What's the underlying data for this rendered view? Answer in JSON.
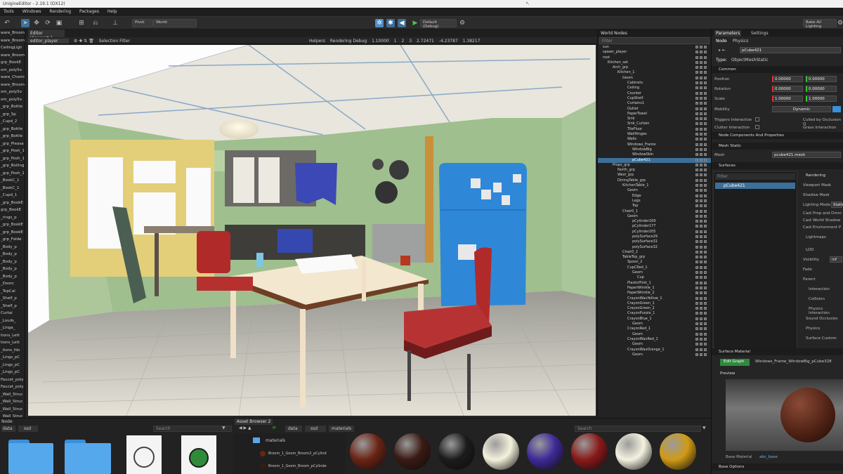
{
  "window": {
    "title": "UnigineEditor - 2.19.1 (DX12)"
  },
  "menu": [
    "Tools",
    "Windows",
    "Rendering",
    "Packages",
    "Help"
  ],
  "toolbar": {
    "pivot_label": "Pivot",
    "space_label": "World",
    "run_config": "Default (Debug)",
    "bake_lighting": "Bake All Lighting"
  },
  "left_panel_items": [
    "ware_Broom",
    "ware_Broom",
    "CeilingLigh",
    "ware_Broom",
    "grp_BookE",
    "om_poly5o",
    "ware_Chemic",
    "ware_Broom",
    "om_poly5o",
    "om_poly5o",
    "_grp_Bottle",
    "_grp_Sp",
    "_Cupd_2",
    "_grp_Bottle",
    "_grp_Bottle",
    "_grp_Pleasa",
    "_grp_Posh_1",
    "_grp_Posh_1",
    "_grp_Boiling",
    "_grp_Posh_1",
    "_BookC_1",
    "_BookC_1",
    "_Cupd_1",
    "_grp_BookE",
    "grp_BookE",
    "_rings_p",
    "_grp_BookE",
    "_grp_BookE",
    "_grp_Folde",
    "_Body_p",
    "_Body_p",
    "_Body_p",
    "_Body_p",
    "_Body_p",
    "_Doorc",
    "_TopCal",
    "_Shelf_p",
    "_Shelf_p",
    "Curtai",
    "_Louds_",
    "_Linga_",
    "tions_Lett",
    "tions_Lett",
    "_tions_fds",
    "_Lings_pC",
    "_Lings_pC",
    "_Lings_pC",
    "Faucet_poly",
    "Faucet_poly",
    "_Wall_Struc",
    "_Wall_Struc",
    "_Wall_Struc",
    "_Wall_Struc"
  ],
  "viewport": {
    "tab_label": "Editor Viewport 1",
    "camera": "editor_player",
    "selection_filter": "Selection Filter",
    "helpers": "Helpers",
    "rendering_debug": "Rendering Debug",
    "fields": [
      "1.10000",
      "1",
      "2",
      "3",
      "2.72471",
      "-4.23787",
      "1.38217"
    ]
  },
  "world_nodes": {
    "tab_label": "World Nodes",
    "filter_placeholder": "Filter",
    "rows": [
      {
        "label": "sun",
        "indent": 1,
        "selected": false
      },
      {
        "label": "spawn_player",
        "indent": 1,
        "selected": false
      },
      {
        "label": "root",
        "indent": 1,
        "selected": false
      },
      {
        "label": "Kitchen_set",
        "indent": 2,
        "selected": false
      },
      {
        "label": "Arch_grp",
        "indent": 3,
        "selected": false
      },
      {
        "label": "Kitchen_1",
        "indent": 4,
        "selected": false
      },
      {
        "label": "Geom",
        "indent": 5,
        "selected": false
      },
      {
        "label": "Cabinets",
        "indent": 6,
        "selected": false
      },
      {
        "label": "Ceiling",
        "indent": 6,
        "selected": false
      },
      {
        "label": "Counter",
        "indent": 6,
        "selected": false
      },
      {
        "label": "CupShelf",
        "indent": 6,
        "selected": false
      },
      {
        "label": "Curtains1",
        "indent": 6,
        "selected": false
      },
      {
        "label": "Outlet",
        "indent": 6,
        "selected": false
      },
      {
        "label": "PaperTowel",
        "indent": 6,
        "selected": false
      },
      {
        "label": "Sink",
        "indent": 6,
        "selected": false
      },
      {
        "label": "Sink_Curtain",
        "indent": 6,
        "selected": false
      },
      {
        "label": "TileFloor",
        "indent": 6,
        "selected": false
      },
      {
        "label": "WallHinges",
        "indent": 6,
        "selected": false
      },
      {
        "label": "Walls",
        "indent": 6,
        "selected": false
      },
      {
        "label": "Windows_Frame",
        "indent": 6,
        "selected": false
      },
      {
        "label": "WindowBig",
        "indent": 7,
        "selected": false
      },
      {
        "label": "WindowSkin",
        "indent": 7,
        "selected": false
      },
      {
        "label": "pCube421",
        "indent": 7,
        "selected": true
      },
      {
        "label": "Props_grp",
        "indent": 3,
        "selected": false
      },
      {
        "label": "North_grp",
        "indent": 4,
        "selected": false
      },
      {
        "label": "West_grp",
        "indent": 4,
        "selected": false
      },
      {
        "label": "DiningTable_grp",
        "indent": 4,
        "selected": false
      },
      {
        "label": "KitchenTable_1",
        "indent": 5,
        "selected": false
      },
      {
        "label": "Geom",
        "indent": 6,
        "selected": false
      },
      {
        "label": "Edge",
        "indent": 7,
        "selected": false
      },
      {
        "label": "Legs",
        "indent": 7,
        "selected": false
      },
      {
        "label": "Top",
        "indent": 7,
        "selected": false
      },
      {
        "label": "Chair0_1",
        "indent": 5,
        "selected": false
      },
      {
        "label": "Geom",
        "indent": 6,
        "selected": false
      },
      {
        "label": "pCylinder169",
        "indent": 7,
        "selected": false
      },
      {
        "label": "pCylinder177",
        "indent": 7,
        "selected": false
      },
      {
        "label": "pCylinder205",
        "indent": 7,
        "selected": false
      },
      {
        "label": "polySurface29",
        "indent": 7,
        "selected": false
      },
      {
        "label": "polySurface31",
        "indent": 7,
        "selected": false
      },
      {
        "label": "polySurface32",
        "indent": 7,
        "selected": false
      },
      {
        "label": "Chair0_2",
        "indent": 5,
        "selected": false
      },
      {
        "label": "TableTop_grp",
        "indent": 5,
        "selected": false
      },
      {
        "label": "Spoon_2",
        "indent": 6,
        "selected": false
      },
      {
        "label": "CupCRed_1",
        "indent": 6,
        "selected": false
      },
      {
        "label": "Geom",
        "indent": 7,
        "selected": false
      },
      {
        "label": "Cup",
        "indent": 8,
        "selected": false
      },
      {
        "label": "PlasticPlink_1",
        "indent": 6,
        "selected": false
      },
      {
        "label": "PaperWrinkle_1",
        "indent": 6,
        "selected": false
      },
      {
        "label": "PaperWrinkle_2",
        "indent": 6,
        "selected": false
      },
      {
        "label": "CrayonWaxYellow_1",
        "indent": 6,
        "selected": false
      },
      {
        "label": "CrayonGreen_1",
        "indent": 6,
        "selected": false
      },
      {
        "label": "CrayonGreen_2",
        "indent": 6,
        "selected": false
      },
      {
        "label": "CrayonPurple_1",
        "indent": 6,
        "selected": false
      },
      {
        "label": "CrayonBlue_1",
        "indent": 6,
        "selected": false
      },
      {
        "label": "Geom",
        "indent": 7,
        "selected": false
      },
      {
        "label": "CrayonRed_1",
        "indent": 6,
        "selected": false
      },
      {
        "label": "Geom",
        "indent": 7,
        "selected": false
      },
      {
        "label": "CrayonWaxRed_1",
        "indent": 6,
        "selected": false
      },
      {
        "label": "Geom",
        "indent": 7,
        "selected": false
      },
      {
        "label": "CrayonWaxOrange_1",
        "indent": 6,
        "selected": false
      },
      {
        "label": "Geom",
        "indent": 7,
        "selected": false
      }
    ]
  },
  "parameters": {
    "tabs": [
      "Parameters",
      "Settings"
    ],
    "subtabs": [
      "Node",
      "Physics"
    ],
    "node_name": "pCube421",
    "type_label": "Type:",
    "type_value": "ObjectMeshStatic",
    "common_label": "Common",
    "position_label": "Position",
    "rotation_label": "Rotation",
    "scale_label": "Scale",
    "position": [
      "0.00000",
      "0.00000"
    ],
    "rotation": [
      "0.00000",
      "0.00000"
    ],
    "scale": [
      "1.00000",
      "1.00000"
    ],
    "mobility_label": "Mobility",
    "mobility_value": "Dynamic",
    "triggers_label": "Triggers Interaction",
    "culled_label": "Culled by Occlusion Q",
    "clutter_label": "Clutter Interaction",
    "grass_label": "Grass Interaction",
    "node_components": "Node Components And Properties",
    "mesh_static": "Mesh Static",
    "mesh_label": "Mesh",
    "mesh_value": "pcube421.mesh",
    "surfaces": "Surfaces",
    "surfaces_filter": "Filter",
    "surface_item": "pCube421",
    "rendering": "Rendering",
    "viewport_mask": "Viewport Mask",
    "shadow_mask": "Shadow Mask",
    "lighting_mode": "Lighting Mode",
    "lighting_value": "Static",
    "cast_prop": "Cast Prop and Omni",
    "cast_world": "Cast World Shadow",
    "cast_env": "Cast Environment P",
    "lightmaps": "Lightmaps",
    "lod": "LOD",
    "visibility_label": "Visibility",
    "visibility_value": "inf",
    "fade_label": "Fade",
    "parent_label": "Parent",
    "interaction": "Interaction",
    "collision": "Collision",
    "physics_interaction": "Physics Interaction",
    "sound_occlusion": "Sound Occlusion",
    "physics": "Physics",
    "surface_custom": "Surface Custom",
    "surface_material": "Surface Material",
    "edit_graph": "Edit Graph",
    "material_path": "Windows_Frame_WindowBig_pCube328",
    "preview": "Preview",
    "base_material": "Base Material",
    "base_material_link": "abc_base",
    "base_options": "Base Options"
  },
  "bottom": {
    "left_tab": "Node",
    "left_tabs": [
      "data",
      "ssd"
    ],
    "search_placeholder": "Search",
    "asset_tab": "Asset Browser 2",
    "asset_tabs": [
      "data",
      "ssd",
      "materials"
    ],
    "tree": [
      {
        "label": "materials"
      },
      {
        "label": "Broom_1_Geom_Broom2_pCylind"
      },
      {
        "label": "Broom_1_Geom_Broom_pCylinde"
      }
    ],
    "spheres": [
      {
        "color": "#6b2414"
      },
      {
        "color": "#3a1a14"
      },
      {
        "color": "#1b1b1b"
      },
      {
        "color": "#f4f1dc"
      },
      {
        "color": "#3f2a98"
      },
      {
        "color": "#8a1919"
      },
      {
        "color": "#f4f2df"
      },
      {
        "color": "#d09a14"
      }
    ]
  }
}
